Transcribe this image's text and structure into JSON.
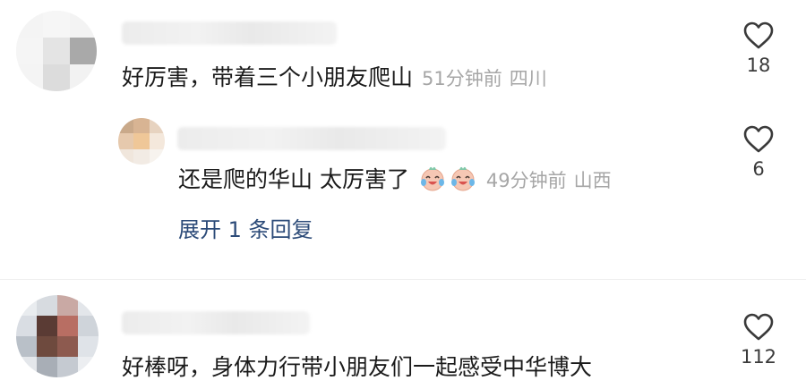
{
  "comments": [
    {
      "text": "好厉害，带着三个小朋友爬山",
      "time": "51分钟前",
      "location": "四川",
      "like_count": "18"
    },
    {
      "text": "还是爬的华山 太厉害了",
      "time": "49分钟前",
      "location": "山西",
      "like_count": "6",
      "emoji": "laughing-tears-emoji",
      "expand_label": "展开 1 条回复"
    },
    {
      "text": "好棒呀，身体力行带小朋友们一起感受中华博大",
      "like_count": "112"
    }
  ],
  "icons": {
    "like": "heart-outline-icon"
  },
  "colors": {
    "text": "#1b1b1b",
    "meta": "#a6a6a6",
    "link": "#2b4a78",
    "like_count": "#3a3a3a"
  }
}
